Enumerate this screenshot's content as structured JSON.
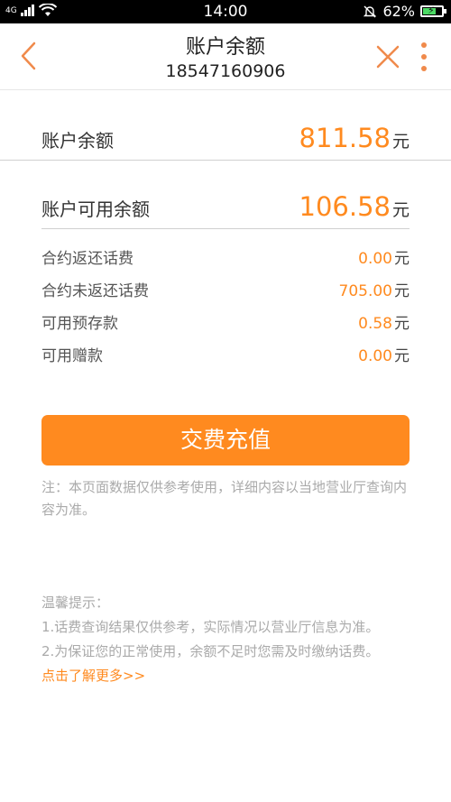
{
  "status_bar": {
    "network": "4G",
    "time": "14:00",
    "battery_percent": "62%",
    "battery_level": 0.62
  },
  "header": {
    "title": "账户余额",
    "phone": "18547160906"
  },
  "balance": {
    "label": "账户余额",
    "value": "811.58",
    "unit": "元"
  },
  "available": {
    "label": "账户可用余额",
    "value": "106.58",
    "unit": "元"
  },
  "details": [
    {
      "label": "合约返还话费",
      "value": "0.00",
      "unit": "元"
    },
    {
      "label": "合约未返还话费",
      "value": "705.00",
      "unit": "元"
    },
    {
      "label": "可用预存款",
      "value": "0.58",
      "unit": "元"
    },
    {
      "label": "可用赠款",
      "value": "0.00",
      "unit": "元"
    }
  ],
  "pay_button": "交费充值",
  "note": "注：本页面数据仅供参考使用，详细内容以当地营业厅查询内容为准。",
  "tips": {
    "title": "温馨提示：",
    "items": [
      "1.话费查询结果仅供参考，实际情况以营业厅信息为准。",
      "2.为保证您的正常使用，余额不足时您需及时缴纳话费。"
    ],
    "link": "点击了解更多>>"
  },
  "colors": {
    "accent": "#ff8a1f",
    "text": "#333333",
    "muted": "#aaaaaa"
  }
}
